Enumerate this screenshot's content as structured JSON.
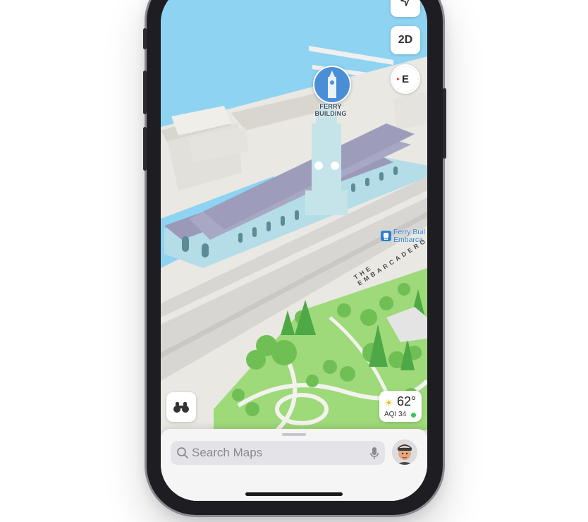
{
  "map": {
    "poi_label": "FERRY\nBUILDING",
    "transit_label": "Ferry Buil\nEmbarca",
    "street_label": "THE EMBARCADERO"
  },
  "controls": {
    "view_mode": "2D",
    "compass_heading": "E"
  },
  "weather": {
    "temperature": "62°",
    "aqi": "AQI 34",
    "icon": "sun-icon",
    "aqi_color": "#34c759"
  },
  "search": {
    "placeholder": "Search Maps"
  },
  "colors": {
    "water": "#8fd3f2",
    "park": "#9ed97a",
    "building_roof": "#a8a8c4",
    "transit_accent": "#2a7fd1"
  }
}
